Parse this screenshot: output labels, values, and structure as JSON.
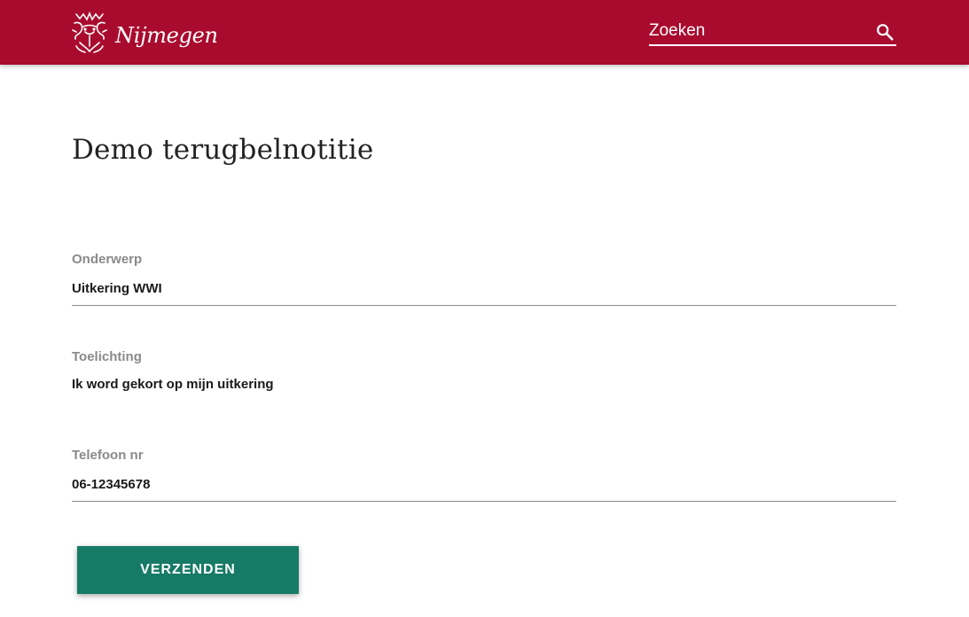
{
  "header": {
    "brand": "Nijmegen",
    "search": {
      "placeholder": "Zoeken",
      "value": ""
    }
  },
  "main": {
    "title": "Demo terugbelnotitie",
    "form": {
      "subject": {
        "label": "Onderwerp",
        "value": "Uitkering WWI"
      },
      "explanation": {
        "label": "Toelichting",
        "value": "Ik word gekort op mijn uitkering"
      },
      "phone": {
        "label": "Telefoon nr",
        "value": "06-12345678"
      },
      "submit_label": "VERZENDEN"
    }
  },
  "colors": {
    "header_bg": "#a90b2e",
    "button_bg": "#177a66"
  },
  "icons": {
    "logo": "nijmegen-emblem-icon",
    "search": "search-icon"
  }
}
